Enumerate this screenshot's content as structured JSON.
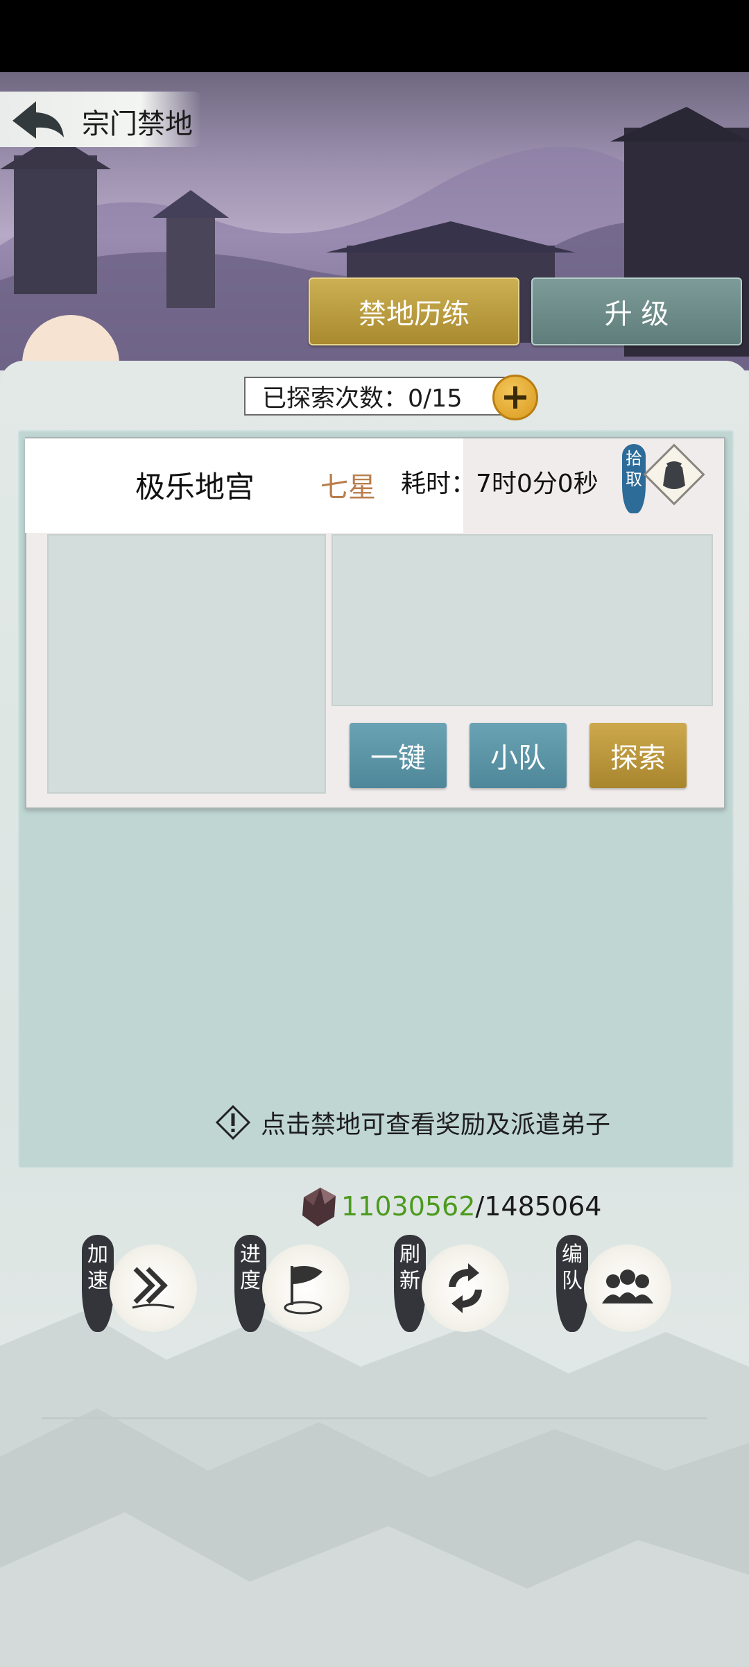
{
  "header": {
    "title": "宗门禁地"
  },
  "tabs": [
    {
      "label": "禁地历练",
      "active": true
    },
    {
      "label": "升 级",
      "active": false
    }
  ],
  "explore_counter": {
    "label": "已探索次数：0/15"
  },
  "card": {
    "name": "极乐地宫",
    "stars": "七星",
    "time": "耗时：7时0分0秒",
    "pick_label": "拾取"
  },
  "card_actions": [
    {
      "label": "一键"
    },
    {
      "label": "小队"
    },
    {
      "label": "探索"
    }
  ],
  "hint": {
    "text": "点击禁地可查看奖励及派遣弟子"
  },
  "resource": {
    "have": "11030562",
    "sep_need": "/1485064"
  },
  "bottom_actions": [
    {
      "label": "加速",
      "icon": "speed-icon"
    },
    {
      "label": "进度",
      "icon": "flag-icon"
    },
    {
      "label": "刷新",
      "icon": "refresh-icon"
    },
    {
      "label": "编队",
      "icon": "team-icon"
    }
  ],
  "colors": {
    "gold": "#b8983a",
    "teal": "#5b93a4",
    "panel": "#bfd6d3",
    "green_value": "#4c9a1e"
  }
}
